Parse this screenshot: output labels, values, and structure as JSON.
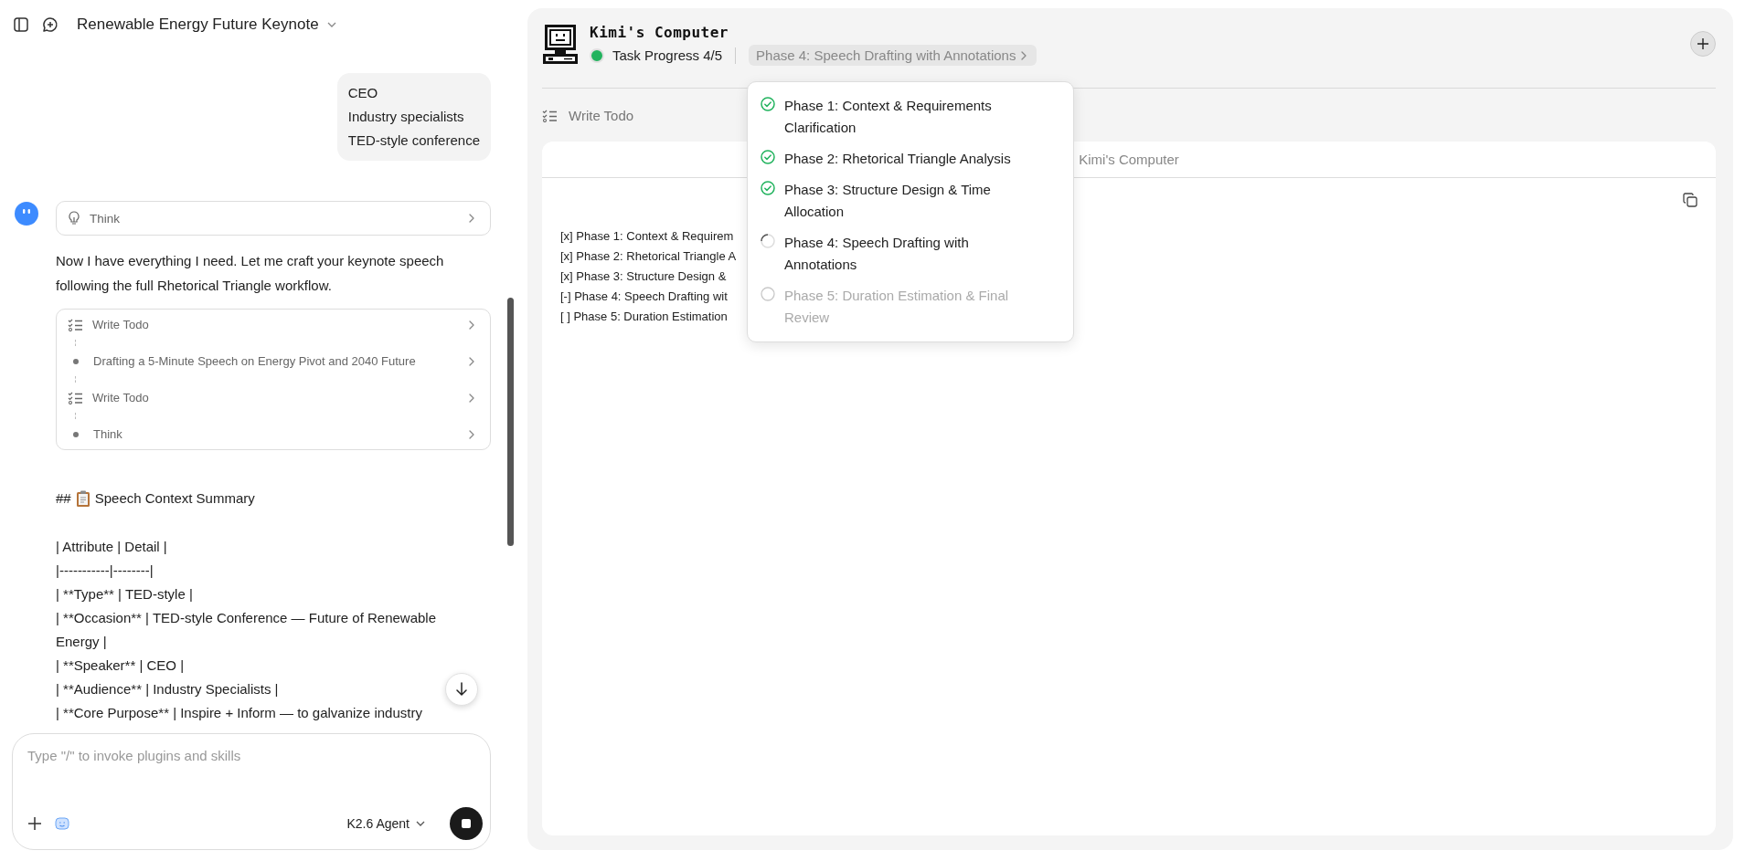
{
  "chat": {
    "title": "Renewable Energy Future Keynote",
    "user_message": [
      "CEO",
      "Industry specialists",
      "TED-style conference"
    ],
    "think": "Think",
    "reply": "Now I have everything I need. Let me craft your keynote speech following the full Rhetorical Triangle workflow.",
    "steps": [
      {
        "kind": "todo",
        "label": "Write Todo"
      },
      {
        "kind": "step",
        "label": "Drafting a 5-Minute Speech on Energy Pivot and 2040 Future"
      },
      {
        "kind": "todo",
        "label": "Write Todo"
      },
      {
        "kind": "step",
        "label": "Think"
      }
    ],
    "heading": {
      "marker": "##",
      "text": "Speech Context Summary"
    },
    "lines": [
      "| Attribute | Detail |",
      "|-----------|--------|",
      "| **Type** | TED-style |",
      "| **Occasion** | TED-style Conference — Future of Renewable Energy |",
      "| **Speaker** | CEO |",
      "| **Audience** | Industry Specialists |",
      "| **Core Purpose** | Inspire + Inform — to galvanize industry"
    ],
    "composer": {
      "placeholder": "Type \"/\" to invoke plugins and skills",
      "model": "K2.6 Agent"
    }
  },
  "computer": {
    "title": "Kimi's Computer",
    "progress": "Task Progress 4/5",
    "phase_chip": "Phase 4: Speech Drafting with Annotations",
    "phases": [
      {
        "label": "Phase 1: Context & Requirements Clarification",
        "checked": true,
        "active": false
      },
      {
        "label": "Phase 2: Rhetorical Triangle Analysis",
        "checked": true,
        "active": false
      },
      {
        "label": "Phase 3: Structure Design & Time Allocation",
        "checked": true,
        "active": false
      },
      {
        "label": "Phase 4: Speech Drafting with Annotations",
        "checked": false,
        "active": true
      },
      {
        "label": "Phase 5: Duration Estimation & Final Review",
        "checked": false,
        "active": false
      }
    ],
    "running": true,
    "tool": "Write Todo",
    "card_title": "Kimi's Computer",
    "todo_lines": [
      "[x] Phase 1: Context & Requirem",
      "[x] Phase 2: Rhetorical Triangle A",
      "[x] Phase 3: Structure Design &",
      "[-] Phase 4: Speech Drafting wit",
      "[ ] Phase 5: Duration Estimation"
    ]
  }
}
